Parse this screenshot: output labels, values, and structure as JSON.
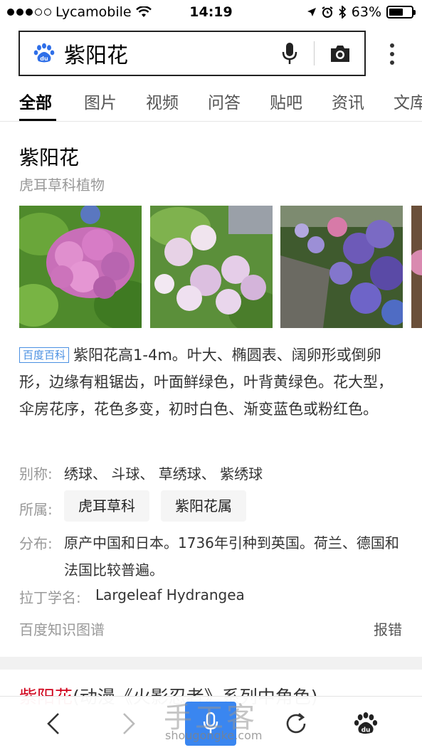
{
  "status": {
    "carrier": "Lycamobile",
    "time": "14:19",
    "battery": "63%",
    "battery_level": 0.63
  },
  "search": {
    "query": "紫阳花"
  },
  "tabs": [
    {
      "label": "全部"
    },
    {
      "label": "图片"
    },
    {
      "label": "视频"
    },
    {
      "label": "问答"
    },
    {
      "label": "贴吧"
    },
    {
      "label": "资讯"
    },
    {
      "label": "文库"
    }
  ],
  "card": {
    "title": "紫阳花",
    "subtitle": "虎耳草科植物",
    "badge": "百度百科",
    "description": "紫阳花高1-4m。叶大、椭圆表、阔卵形或倒卵形，边缘有粗锯齿，叶面鲜绿色，叶背黄绿色。花大型，伞房花序，花色多变，初时白色、渐变蓝色或粉红色。",
    "alias_label": "别称:",
    "alias_value": "绣球、 斗球、 草绣球、 紫绣球",
    "belongs_label": "所属:",
    "belongs_chips": [
      "虎耳草科",
      "紫阳花属"
    ],
    "distribution_label": "分布:",
    "distribution_value": "原产中国和日本。1736年引种到英国。荷兰、德国和法国比较普遍。",
    "latin_label": "拉丁学名:",
    "latin_value": "Largeleaf Hydrangea",
    "source": "百度知识图谱",
    "report": "报错"
  },
  "next_result": {
    "highlight": "紫阳花",
    "rest": "(动漫《火影忍者》系列中角色)"
  },
  "watermark": {
    "main": "手工客",
    "sub": "shougongke.com"
  }
}
